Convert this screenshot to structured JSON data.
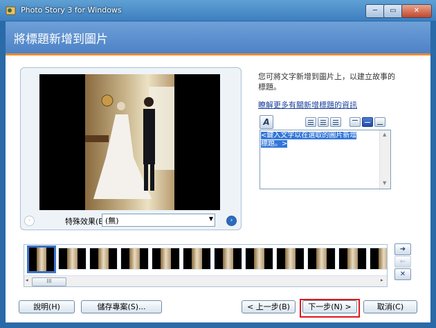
{
  "window": {
    "title": "Photo Story 3 for Windows",
    "min_label": "─",
    "max_label": "▭",
    "close_label": "✕"
  },
  "header": {
    "title": "將標題新增到圖片"
  },
  "preview": {
    "prev_arrow": "‹",
    "next_arrow": "›",
    "effect_label": "特殊效果(E):",
    "effect_value": "(無)"
  },
  "right": {
    "description": "您可將文字新增到圖片上，以建立故事的標題。",
    "learn_more_link": "瞭解更多有關新增標題的資訊",
    "font_button_label": "A",
    "title_text": "<鍵入文字以在選取的圖片新增標題。>"
  },
  "filmstrip": {
    "frame_count": 12,
    "active_index": 0,
    "scroll_thumb": "III",
    "left_arrow": "◂",
    "right_arrow": "▸"
  },
  "side_buttons": {
    "forward": "➜",
    "back": "←",
    "remove": "✕"
  },
  "buttons": {
    "help": "說明(H)",
    "save_project": "儲存專案(S)...",
    "back": "< 上一步(B)",
    "next": "下一步(N) >",
    "cancel": "取消(C)"
  },
  "colors": {
    "accent_rule": "#f08c2e",
    "header_blue": "#5b8fd0",
    "highlight_red": "#e0161b"
  }
}
